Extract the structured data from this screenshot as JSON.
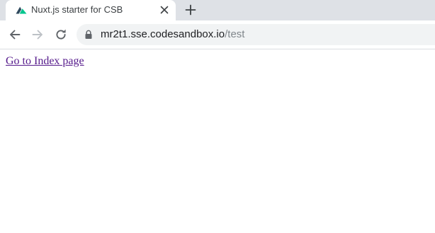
{
  "browser": {
    "tab": {
      "title": "Nuxt.js starter for CSB",
      "favicon": "nuxt-logo-icon"
    },
    "new_tab_icon": "plus-icon",
    "toolbar": {
      "back_icon": "arrow-left-icon",
      "forward_icon": "arrow-right-icon",
      "reload_icon": "reload-icon",
      "lock_icon": "lock-icon",
      "url_host": "mr2t1.sse.codesandbox.io",
      "url_path": "/test"
    }
  },
  "page": {
    "link_text": "Go to Index page"
  },
  "colors": {
    "tab_strip": "#dee1e6",
    "omnibox": "#f1f3f4",
    "visited_link": "#551a8b",
    "nuxt_green": "#00c58e"
  }
}
